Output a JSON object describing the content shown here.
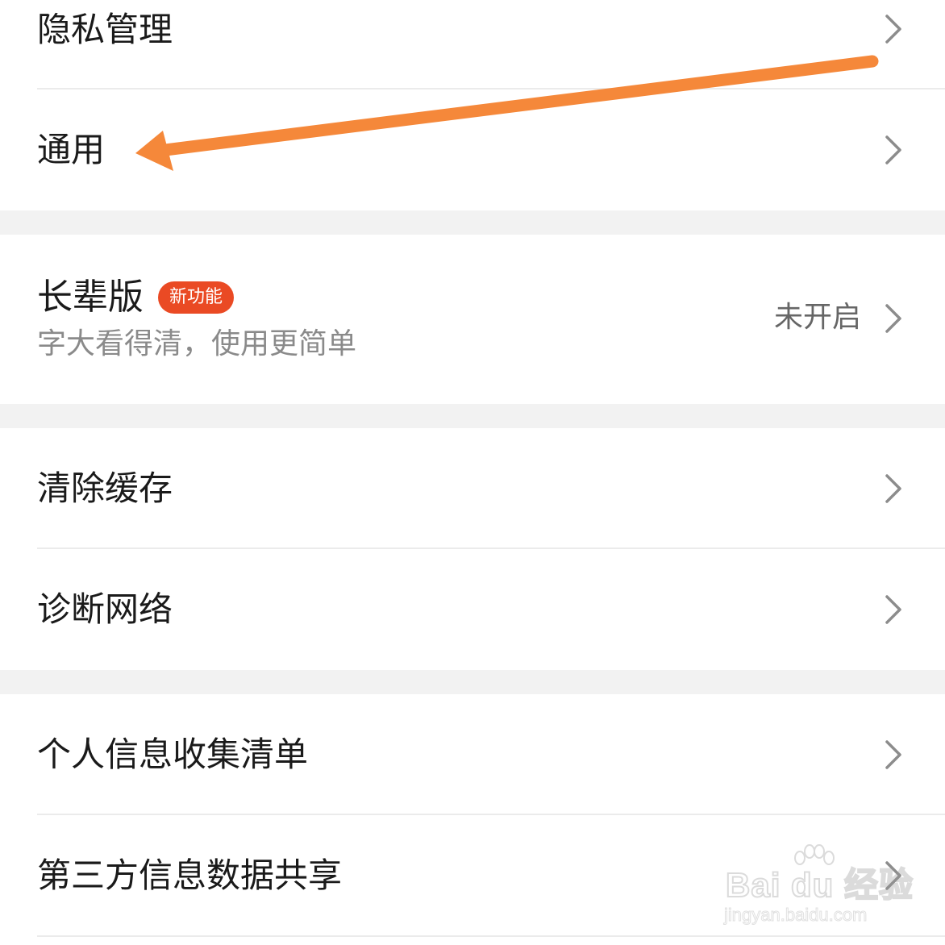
{
  "settings": {
    "privacy": {
      "label": "隐私管理"
    },
    "general": {
      "label": "通用"
    },
    "elder_mode": {
      "label": "长辈版",
      "badge": "新功能",
      "subtitle": "字大看得清，使用更简单",
      "status": "未开启"
    },
    "clear_cache": {
      "label": "清除缓存"
    },
    "diagnose_network": {
      "label": "诊断网络"
    },
    "personal_info_list": {
      "label": "个人信息收集清单"
    },
    "third_party_sharing": {
      "label": "第三方信息数据共享"
    }
  },
  "annotation": {
    "arrow_color": "#f5883a",
    "target": "通用"
  },
  "watermark": {
    "brand": "Bai du 经验",
    "url": "jingyan.baidu.com"
  },
  "colors": {
    "badge": "#ea4a24",
    "section_gap": "#f2f2f2",
    "divider": "#ebebeb"
  }
}
